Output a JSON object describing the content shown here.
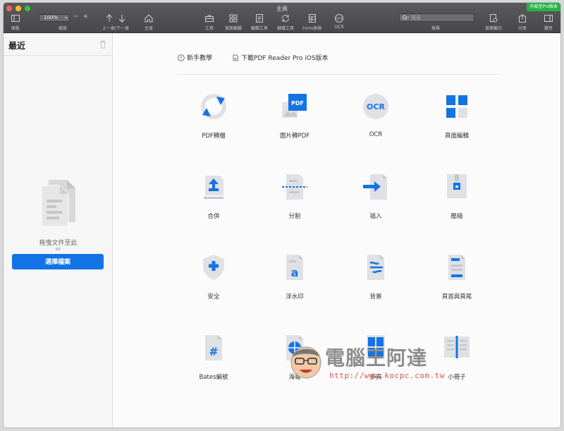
{
  "window": {
    "title": "主頁",
    "promo_label": "升級至Pro版本"
  },
  "toolbar": {
    "panel_label": "面板",
    "zoom_value": "100%",
    "zoom_label": "縮放",
    "prevnext_label": "上一頁/下一頁",
    "home_label": "主頁",
    "tools_label": "工具",
    "page_edit_label": "頁面編輯",
    "edit_tools_label": "編輯工具",
    "convert_tools_label": "轉檔工具",
    "form_label": "Form表格",
    "ocr_label": "OCR",
    "search_placeholder": "搜尋",
    "search_label": "搜尋",
    "page_display_label": "頁面顯示",
    "share_label": "分享",
    "properties_label": "屬性"
  },
  "sidebar": {
    "title": "最近",
    "drop_text": "拖曳文件至此",
    "or_text": "or",
    "choose_button": "選擇檔案"
  },
  "main": {
    "tutorial_link": "新手教學",
    "download_link": "下載PDF Reader Pro iOS版本",
    "tools": [
      {
        "label": "PDF轉檔",
        "icon": "convert-icon"
      },
      {
        "label": "圖片轉PDF",
        "icon": "image-to-pdf-icon"
      },
      {
        "label": "OCR",
        "icon": "ocr-icon"
      },
      {
        "label": "頁面編輯",
        "icon": "page-edit-icon"
      },
      {
        "label": "合併",
        "icon": "merge-icon"
      },
      {
        "label": "分割",
        "icon": "split-icon"
      },
      {
        "label": "插入",
        "icon": "insert-icon"
      },
      {
        "label": "壓縮",
        "icon": "compress-icon"
      },
      {
        "label": "安全",
        "icon": "security-icon"
      },
      {
        "label": "浮水印",
        "icon": "watermark-icon"
      },
      {
        "label": "背景",
        "icon": "background-icon"
      },
      {
        "label": "頁首與頁尾",
        "icon": "header-footer-icon"
      },
      {
        "label": "Bates編號",
        "icon": "bates-icon"
      },
      {
        "label": "海報",
        "icon": "poster-icon"
      },
      {
        "label": "多頁",
        "icon": "multipage-icon"
      },
      {
        "label": "小冊子",
        "icon": "booklet-icon"
      }
    ],
    "pdf_badge": "PDF",
    "ocr_badge": "OCR"
  },
  "watermark": {
    "title": "電腦王阿達",
    "url": "http://www.kocpc.com.tw"
  },
  "colors": {
    "accent": "#1473e6",
    "toolbar": "#4f4f51",
    "sidebar": "#f6f6f6",
    "icon_gray": "#dfe1e4"
  }
}
